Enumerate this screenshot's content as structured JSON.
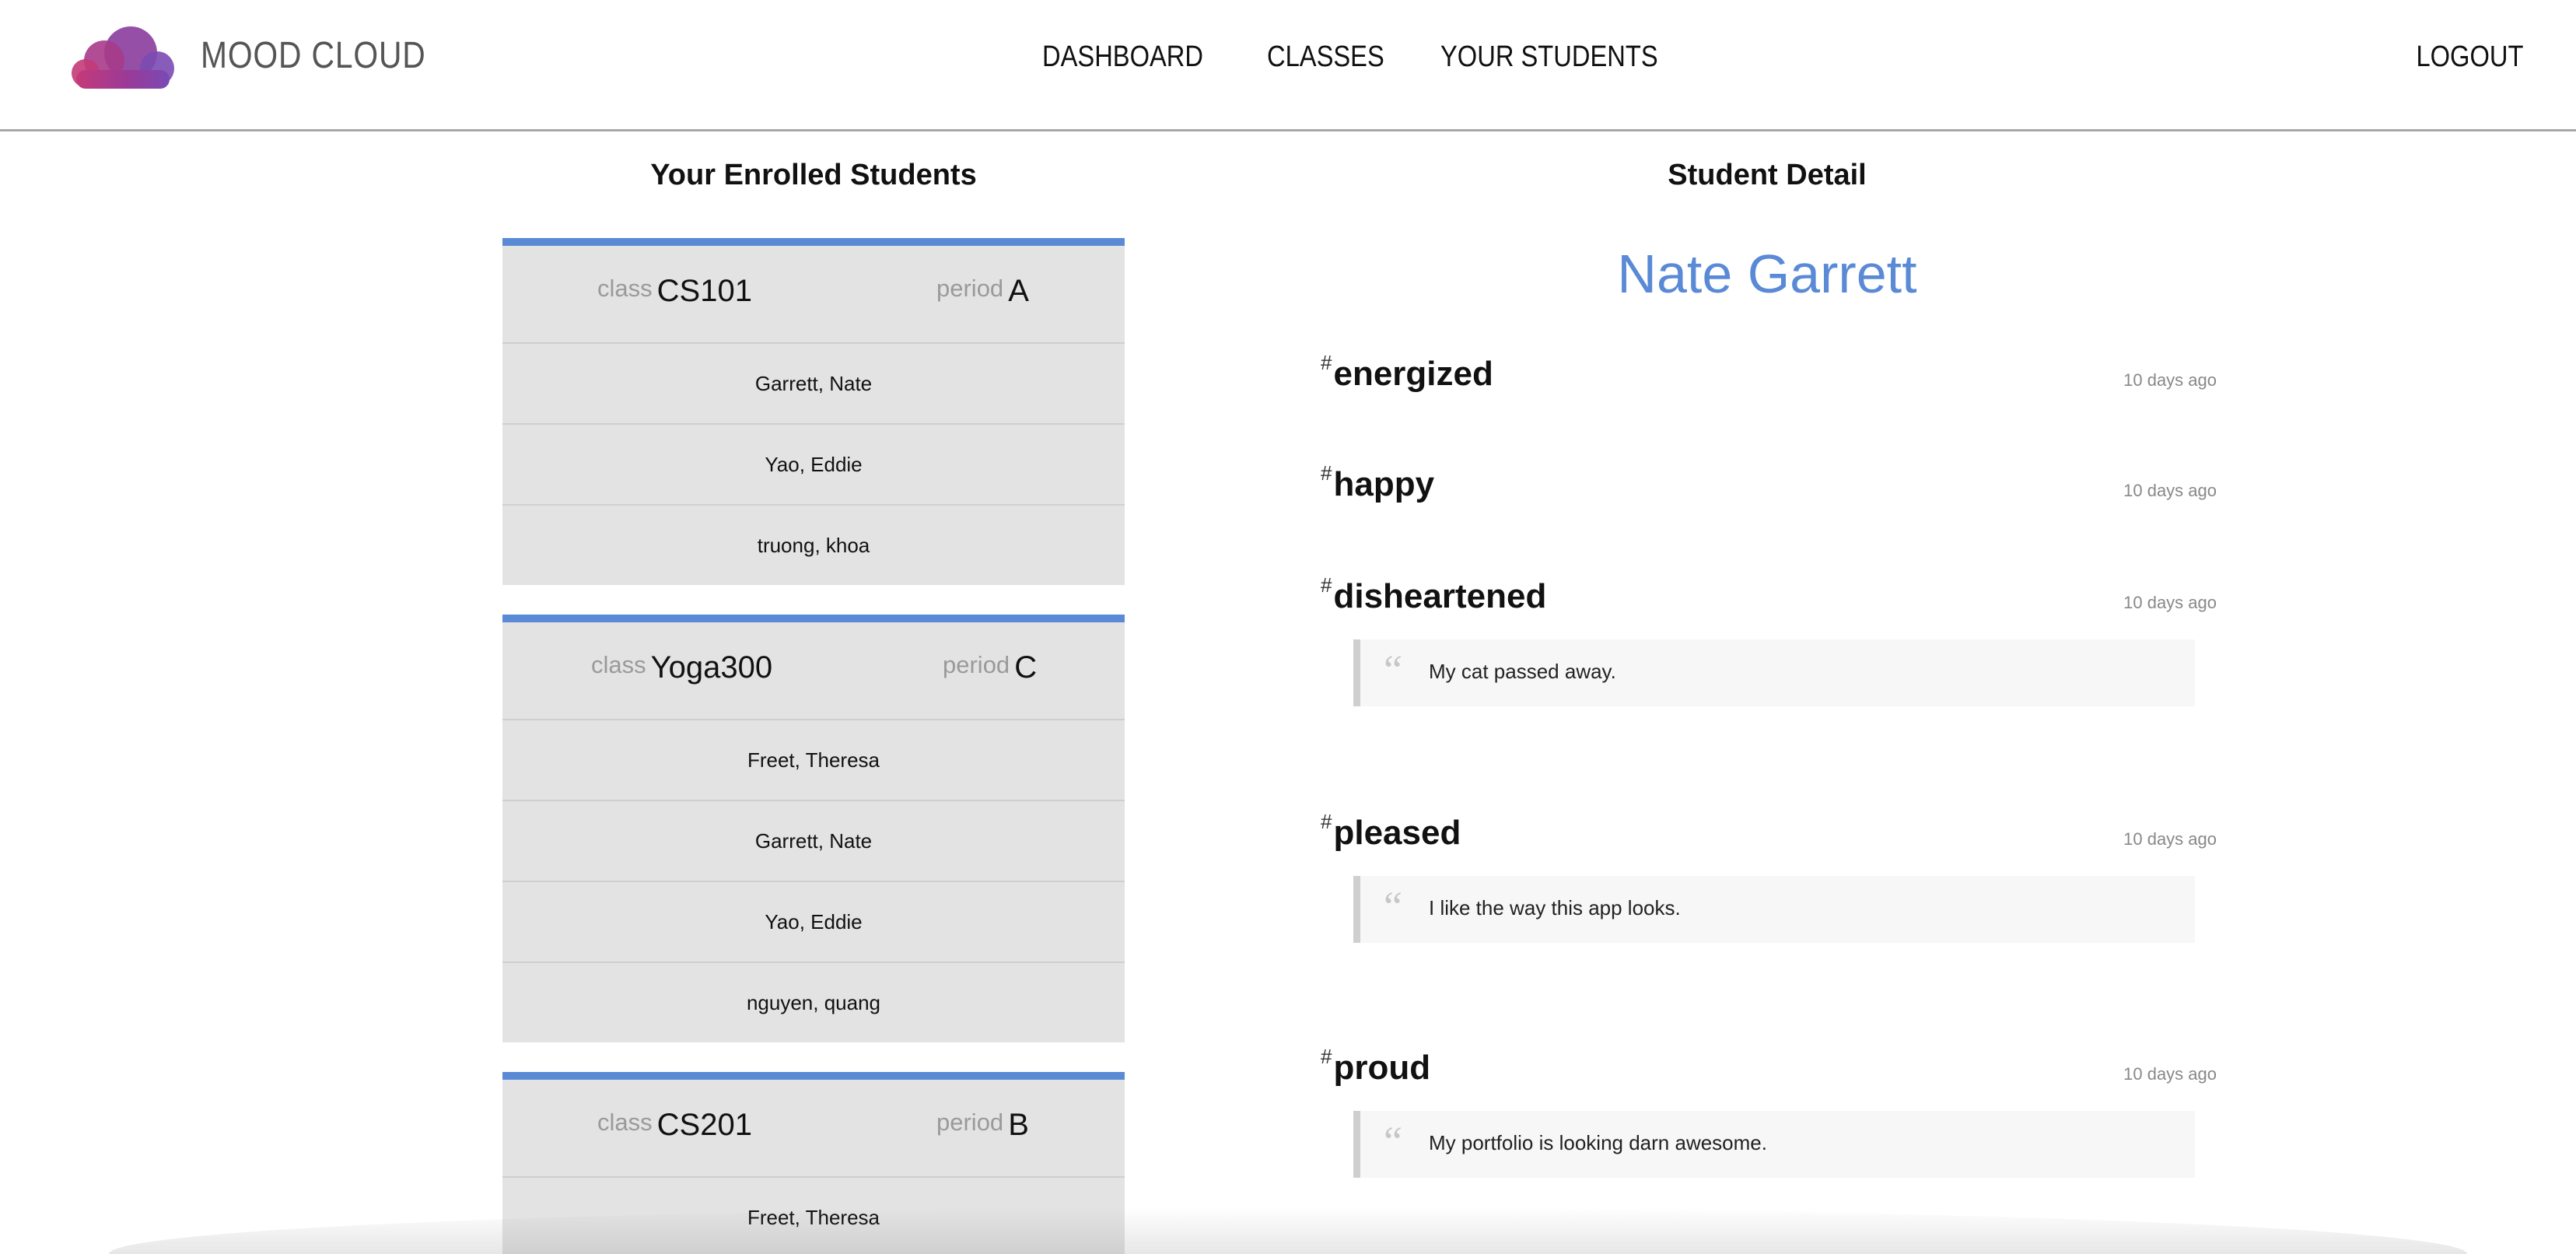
{
  "header": {
    "brand": "MOOD CLOUD",
    "nav": [
      "DASHBOARD",
      "CLASSES",
      "YOUR STUDENTS"
    ],
    "logout": "LOGOUT",
    "logo_colors": [
      "#7b3b96",
      "#b43a7d",
      "#8a4ab0"
    ]
  },
  "enrolled": {
    "title": "Your Enrolled Students",
    "class_label": "class",
    "period_label": "period",
    "classes": [
      {
        "name": "CS101",
        "period": "A",
        "students": [
          "Garrett, Nate",
          "Yao, Eddie",
          "truong, khoa"
        ]
      },
      {
        "name": "Yoga300",
        "period": "C",
        "students": [
          "Freet, Theresa",
          "Garrett, Nate",
          "Yao, Eddie",
          "nguyen, quang"
        ]
      },
      {
        "name": "CS201",
        "period": "B",
        "students": [
          "Freet, Theresa"
        ]
      }
    ]
  },
  "detail": {
    "title": "Student Detail",
    "student_name": "Nate Garrett",
    "moods": [
      {
        "tag": "energized",
        "time": "10 days ago",
        "note": ""
      },
      {
        "tag": "happy",
        "time": "10 days ago",
        "note": ""
      },
      {
        "tag": "disheartened",
        "time": "10 days ago",
        "note": "My cat passed away."
      },
      {
        "tag": "pleased",
        "time": "10 days ago",
        "note": "I like the way this app looks."
      },
      {
        "tag": "proud",
        "time": "10 days ago",
        "note": "My portfolio is looking darn awesome."
      }
    ]
  },
  "colors": {
    "accent": "#5a8ad6",
    "card_bg": "#e3e3e3"
  }
}
